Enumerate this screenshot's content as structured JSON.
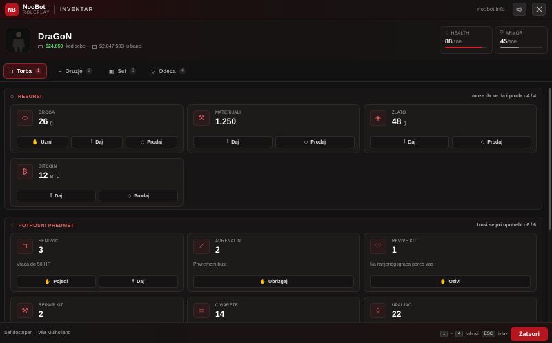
{
  "header": {
    "logo_text": "NB",
    "brand_name": "NooBot",
    "brand_sub": "ROLEPLAY",
    "title": "INVENTAR",
    "url": "noobot.info",
    "sound_icon": "speaker-icon",
    "close_icon": "close-icon"
  },
  "player": {
    "name": "DraGoN",
    "cash": "$24.850",
    "cash_suffix": "kod sebe",
    "bank": "$2.847.500",
    "bank_suffix": "u banci",
    "health_label": "HEALTH",
    "health_value": "88",
    "health_max": "/100",
    "health_pct": 0.88,
    "armor_label": "ARMOR",
    "armor_value": "45",
    "armor_max": "/100",
    "armor_pct": 0.45
  },
  "tabs": [
    {
      "label": "Torba",
      "count": "1"
    },
    {
      "label": "Oruzje",
      "count": "2"
    },
    {
      "label": "Sef",
      "count": "3"
    },
    {
      "label": "Odeca",
      "count": "4"
    }
  ],
  "resursi": {
    "title": "RESURSI",
    "note": "moze da se da i proda - 4 / 4",
    "items": [
      {
        "label": "DROGA",
        "value": "26",
        "unit": "g",
        "actions": [
          "Uzmi",
          "Daj",
          "Prodaj"
        ]
      },
      {
        "label": "MATERIJALI",
        "value": "1.250",
        "unit": "",
        "actions": [
          "Daj",
          "Prodaj"
        ]
      },
      {
        "label": "ZLATO",
        "value": "48",
        "unit": "g",
        "actions": [
          "Daj",
          "Prodaj"
        ]
      },
      {
        "label": "BITCOIN",
        "value": "12",
        "unit": "BTC",
        "actions": [
          "Daj",
          "Prodaj"
        ]
      }
    ]
  },
  "potrosni": {
    "title": "POTROSNI PREDMETI",
    "note": "trosi se pri upotrebi - 6 / 6",
    "items": [
      {
        "label": "SENDVIC",
        "value": "3",
        "desc": "Vraca do 50 HP",
        "actions": [
          "Pojedi",
          "Daj"
        ]
      },
      {
        "label": "ADRENALIN",
        "value": "2",
        "desc": "Privremeni bust",
        "actions": [
          "Ubrizgaj"
        ]
      },
      {
        "label": "REVIVE KIT",
        "value": "1",
        "desc": "Na ranjenog igraca pored vas",
        "actions": [
          "Ozivi"
        ]
      },
      {
        "label": "REPAIR KIT",
        "value": "2",
        "desc": "",
        "actions": []
      },
      {
        "label": "CIGARETE",
        "value": "14",
        "desc": "",
        "actions": []
      },
      {
        "label": "UPALJAC",
        "value": "22",
        "desc": "",
        "actions": []
      }
    ]
  },
  "footer": {
    "status": "Sef dostupan – Vila Mulholland",
    "key1": "1",
    "key_sep": "-",
    "key2": "4",
    "key_tabs": "tabovi",
    "key_esc": "ESC",
    "key_exit": "izlaz",
    "close_label": "Zatvori"
  },
  "colors": {
    "accent": "#b3161e",
    "health": "#d0262e",
    "armor": "#9a9a9a",
    "cash": "#55d36a"
  }
}
